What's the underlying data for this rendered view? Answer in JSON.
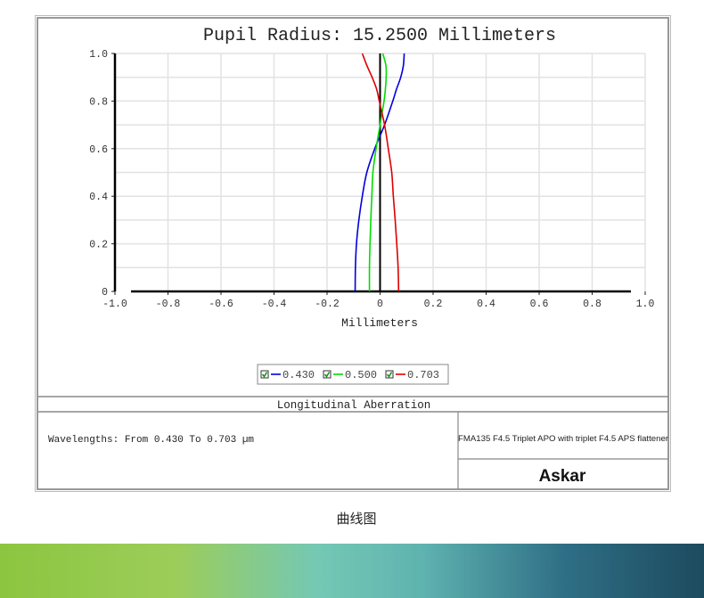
{
  "chart_data": {
    "type": "line",
    "title": "Pupil Radius: 15.2500 Millimeters",
    "xlabel": "Millimeters",
    "ylabel": "",
    "xlim": [
      -1.0,
      1.0
    ],
    "ylim": [
      0,
      1.0
    ],
    "xticks": [
      "-1.0",
      "-0.8",
      "-0.6",
      "-0.4",
      "-0.2",
      "0",
      "0.2",
      "0.4",
      "0.6",
      "0.8",
      "1.0"
    ],
    "xtick_values": [
      -1.0,
      -0.8,
      -0.6,
      -0.4,
      -0.2,
      0,
      0.2,
      0.4,
      0.6,
      0.8,
      1.0
    ],
    "yticks": [
      "0",
      "0.2",
      "0.4",
      "0.6",
      "0.8",
      "1.0"
    ],
    "ytick_values": [
      0,
      0.2,
      0.4,
      0.6,
      0.8,
      1.0
    ],
    "grid": true,
    "legend_position": "bottom-center",
    "y": [
      0,
      0.1,
      0.2,
      0.3,
      0.4,
      0.5,
      0.6,
      0.7,
      0.8,
      0.85,
      0.9,
      0.95,
      1.0
    ],
    "series": [
      {
        "name": "0.430",
        "color": "#0000dd",
        "values": [
          -0.094,
          -0.093,
          -0.089,
          -0.08,
          -0.067,
          -0.05,
          -0.02,
          0.017,
          0.048,
          0.062,
          0.078,
          0.088,
          0.091
        ]
      },
      {
        "name": "0.500",
        "color": "#00dd00",
        "values": [
          -0.04,
          -0.04,
          -0.038,
          -0.035,
          -0.031,
          -0.027,
          -0.015,
          0.0,
          0.015,
          0.02,
          0.023,
          0.022,
          0.01
        ]
      },
      {
        "name": "0.703",
        "color": "#dd0000",
        "values": [
          0.07,
          0.068,
          0.063,
          0.057,
          0.05,
          0.044,
          0.031,
          0.017,
          -0.003,
          -0.013,
          -0.03,
          -0.05,
          -0.067
        ]
      }
    ]
  },
  "footer": {
    "plot_type": "Longitudinal Aberration",
    "wavelengths": "Wavelengths: From 0.430 To 0.703 µm",
    "lens_description": "FMA135 F4.5 Triplet APO with triplet F4.5 APS flattener",
    "brand": "Askar"
  },
  "caption": "曲线图"
}
